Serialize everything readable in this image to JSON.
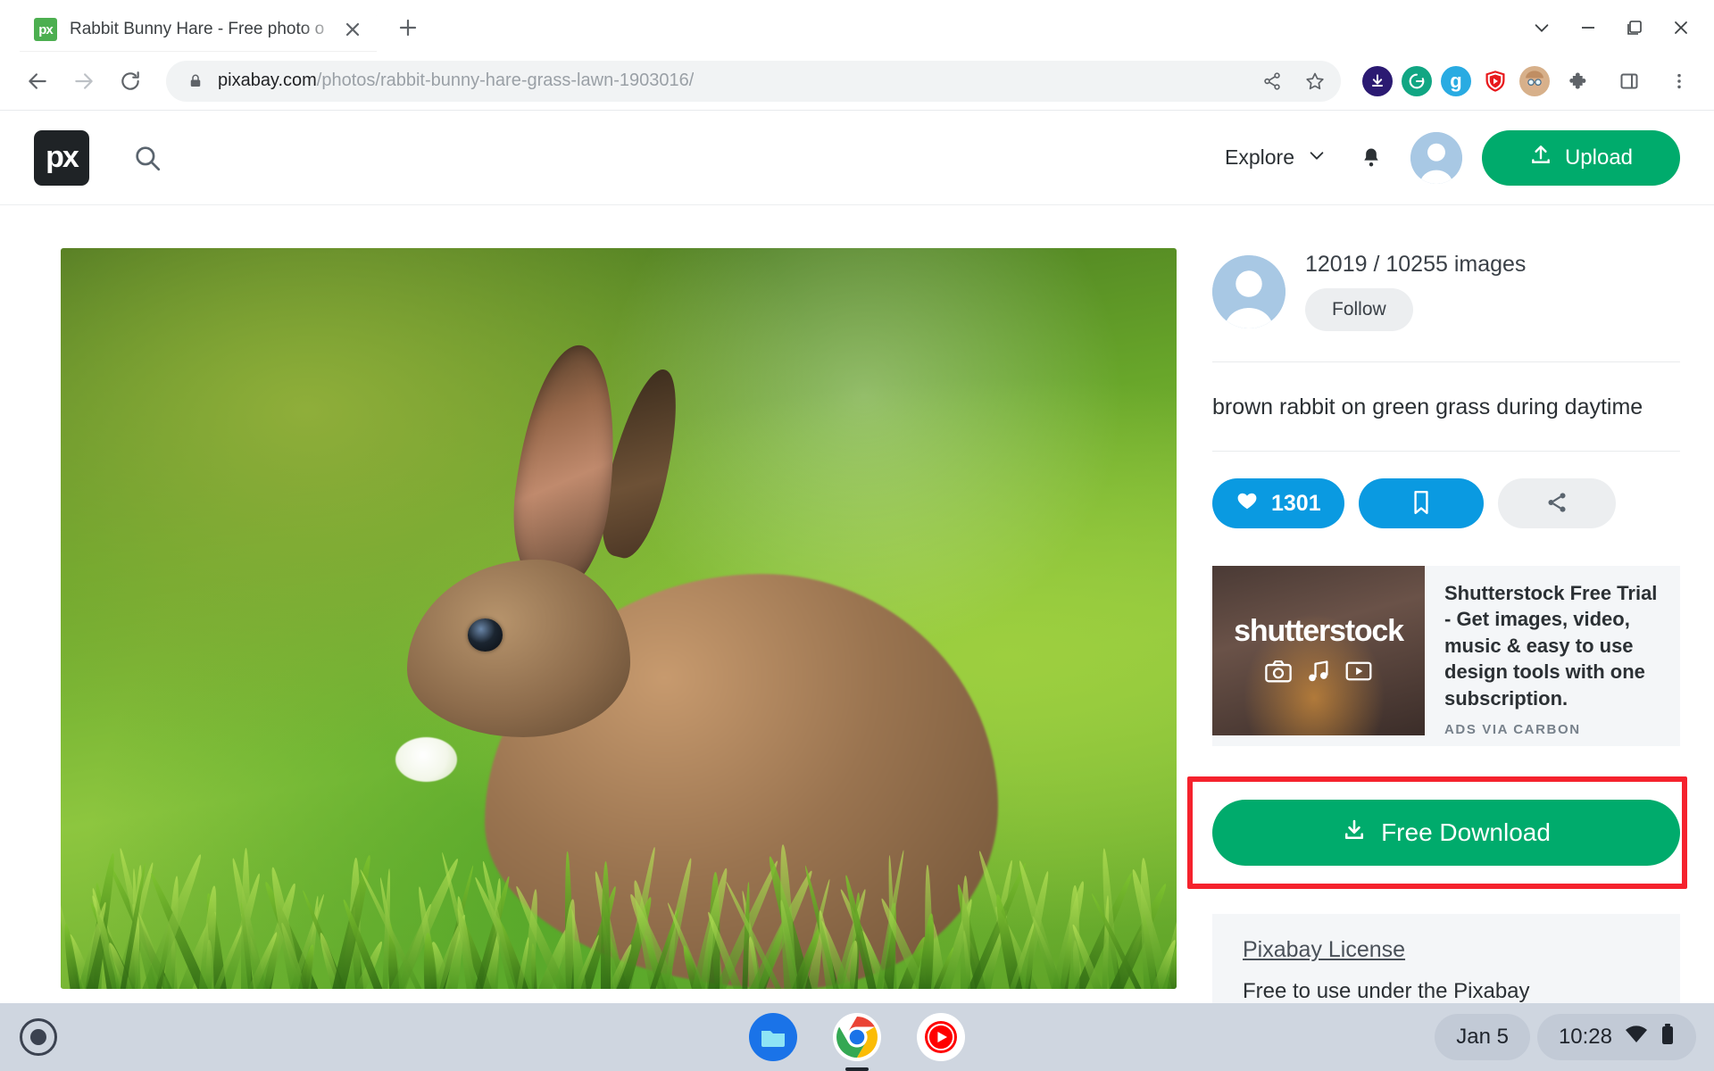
{
  "browser": {
    "tab": {
      "title": "Rabbit Bunny Hare - Free photo o",
      "favicon_text": "px",
      "close_icon": "close-icon",
      "newtab_icon": "plus-icon"
    },
    "window_controls": {
      "dropdown_icon": "chevron-down-icon",
      "minimize_icon": "minimize-icon",
      "maximize_icon": "restore-icon",
      "close_icon": "close-icon"
    },
    "toolbar": {
      "back_icon": "back-arrow-icon",
      "forward_icon": "forward-arrow-icon",
      "reload_icon": "reload-icon",
      "lock_icon": "lock-icon",
      "url_domain": "pixabay.com",
      "url_path": "/photos/rabbit-bunny-hare-grass-lawn-1903016/",
      "share_icon": "share-icon",
      "bookmark_icon": "star-icon",
      "menu_icon": "three-dot-menu-icon",
      "side_panel_icon": "side-panel-icon",
      "extensions_icon": "puzzle-piece-icon",
      "extensions": [
        {
          "name": "download-manager-extension",
          "glyph": "⬇",
          "bg": "#2b1a72",
          "fg": "#ffffff"
        },
        {
          "name": "grammarly-extension",
          "glyph": "G",
          "bg": "#11a683",
          "fg": "#ffffff"
        },
        {
          "name": "g-extension",
          "glyph": "g",
          "bg": "#29abe2",
          "fg": "#ffffff"
        },
        {
          "name": "adblock-extension",
          "glyph": "▶",
          "bg": "#e8191c",
          "fg": "#ffffff"
        },
        {
          "name": "profile-avatar-extension",
          "glyph": "👵",
          "bg": "#d8b08c",
          "fg": "#3a2a1c"
        }
      ]
    }
  },
  "site": {
    "logo_text": "px",
    "search_icon": "search-icon",
    "explore_label": "Explore",
    "explore_chevron": "chevron-down-icon",
    "bell_icon": "notification-bell-icon",
    "avatar_icon": "user-avatar-icon",
    "upload_label": "Upload",
    "upload_icon": "upload-icon",
    "accent_green": "#00ab6c",
    "accent_blue": "#0a9ae1"
  },
  "photo": {
    "alt": "brown rabbit on green grass during daytime"
  },
  "sidebar": {
    "author": {
      "avatar_icon": "user-avatar-icon",
      "images_count": "12019 / 10255 images",
      "follow_label": "Follow"
    },
    "description": "brown rabbit on green grass during daytime",
    "actions": {
      "like_count": "1301",
      "heart_icon": "heart-icon",
      "save_icon": "bookmark-icon",
      "share_icon": "share-icon"
    },
    "ad": {
      "brand": "shutterstock",
      "headline": "Shutterstock Free Trial - Get images, video, music & easy to use design tools with one subscription.",
      "via": "ADS VIA CARBON",
      "icons": [
        "camera-icon",
        "music-note-icon",
        "video-play-icon"
      ]
    },
    "download": {
      "label": "Free Download",
      "icon": "download-icon",
      "highlight_color": "#f5222d"
    },
    "license": {
      "link_label": "Pixabay License",
      "text": "Free to use under the Pixabay"
    }
  },
  "shelf": {
    "launcher_icon": "launcher-circle-icon",
    "apps": [
      {
        "name": "files-app-icon"
      },
      {
        "name": "chrome-app-icon"
      },
      {
        "name": "youtube-music-app-icon"
      }
    ],
    "date": "Jan 5",
    "time": "10:28",
    "wifi_icon": "wifi-icon",
    "battery_icon": "battery-icon"
  }
}
